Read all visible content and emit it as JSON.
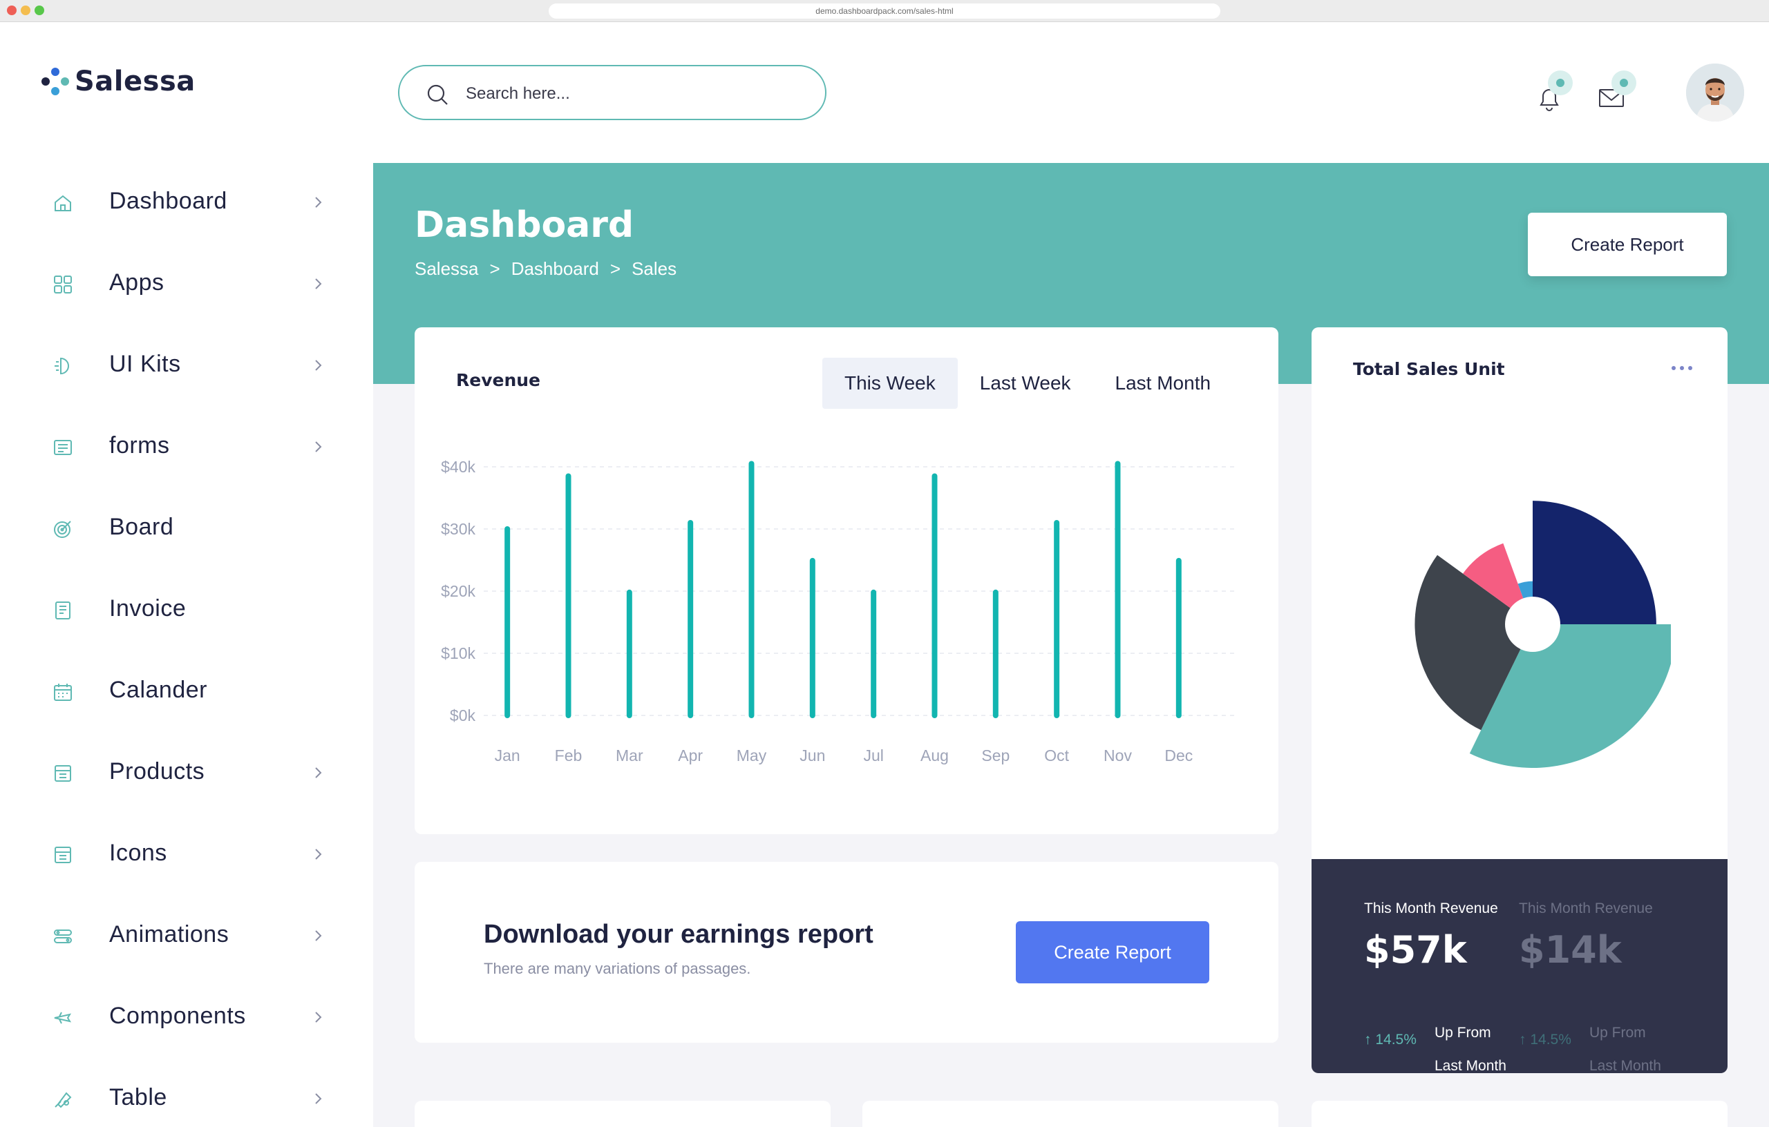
{
  "browser": {
    "url": "demo.dashboardpack.com/sales-html"
  },
  "brand": {
    "name": "Salessa",
    "accent": "#5fb9b3",
    "primary": "#5277f0",
    "dark": "#1f2340"
  },
  "sidebar": {
    "items": [
      {
        "label": "Dashboard",
        "icon": "home-icon",
        "chevron": true
      },
      {
        "label": "Apps",
        "icon": "grid-icon",
        "chevron": true
      },
      {
        "label": "UI Kits",
        "icon": "ui-kit-icon",
        "chevron": true
      },
      {
        "label": "forms",
        "icon": "form-icon",
        "chevron": true
      },
      {
        "label": "Board",
        "icon": "target-icon",
        "chevron": false
      },
      {
        "label": "Invoice",
        "icon": "invoice-icon",
        "chevron": false
      },
      {
        "label": "Calander",
        "icon": "calendar-icon",
        "chevron": false
      },
      {
        "label": "Products",
        "icon": "products-icon",
        "chevron": true
      },
      {
        "label": "Icons",
        "icon": "icons-icon",
        "chevron": true
      },
      {
        "label": "Animations",
        "icon": "animation-icon",
        "chevron": true
      },
      {
        "label": "Components",
        "icon": "components-icon",
        "chevron": true
      },
      {
        "label": "Table",
        "icon": "table-icon",
        "chevron": true
      }
    ]
  },
  "header": {
    "search_placeholder": "Search here...",
    "notification_icon": "bell-icon",
    "mail_icon": "mail-icon"
  },
  "banner": {
    "title": "Dashboard",
    "breadcrumb": [
      "Salessa",
      ">",
      "Dashboard",
      ">",
      "Sales"
    ],
    "create_report_label": "Create Report"
  },
  "revenue": {
    "title": "Revenue",
    "tabs": [
      "This Week",
      "Last Week",
      "Last Month"
    ],
    "active_tab": 0
  },
  "chart_data": [
    {
      "type": "bar",
      "title": "Revenue",
      "categories": [
        "Jan",
        "Feb",
        "Mar",
        "Apr",
        "May",
        "Jun",
        "Jul",
        "Aug",
        "Sep",
        "Oct",
        "Nov",
        "Dec"
      ],
      "values": [
        30000,
        38500,
        19800,
        31000,
        40500,
        24900,
        19800,
        38500,
        19800,
        31000,
        40500,
        24900
      ],
      "ytick_labels": [
        "$0k",
        "$10k",
        "$20k",
        "$30k",
        "$40k"
      ],
      "yticks": [
        0,
        10000,
        20000,
        30000,
        40000
      ],
      "ylim": [
        0,
        40000
      ],
      "grid": true,
      "color": "#12b5b0"
    },
    {
      "type": "pie",
      "title": "Total Sales Unit",
      "variant": "polar-area",
      "slices": [
        {
          "value": 90,
          "radius": 0.86,
          "color": "#14246b"
        },
        {
          "value": 116,
          "radius": 1.0,
          "color": "#5fb9b3"
        },
        {
          "value": 100,
          "radius": 0.82,
          "color": "#3e444c"
        },
        {
          "value": 34,
          "radius": 0.6,
          "color": "#f55d82"
        },
        {
          "value": 20,
          "radius": 0.3,
          "color": "#3a9fd8"
        }
      ]
    }
  ],
  "earnings": {
    "title": "Download your earnings report",
    "subtitle": "There are many variations of passages.",
    "button_label": "Create Report"
  },
  "sales_unit": {
    "title": "Total Sales Unit",
    "blocks": [
      {
        "label": "This Month Revenue",
        "value": "$57k",
        "pct": "14.5%",
        "from_line1": "Up From",
        "from_line2": "Last Month",
        "muted": false
      },
      {
        "label": "This Month Revenue",
        "value": "$14k",
        "pct": "14.5%",
        "from_line1": "Up From",
        "from_line2": "Last Month",
        "muted": true
      }
    ]
  }
}
